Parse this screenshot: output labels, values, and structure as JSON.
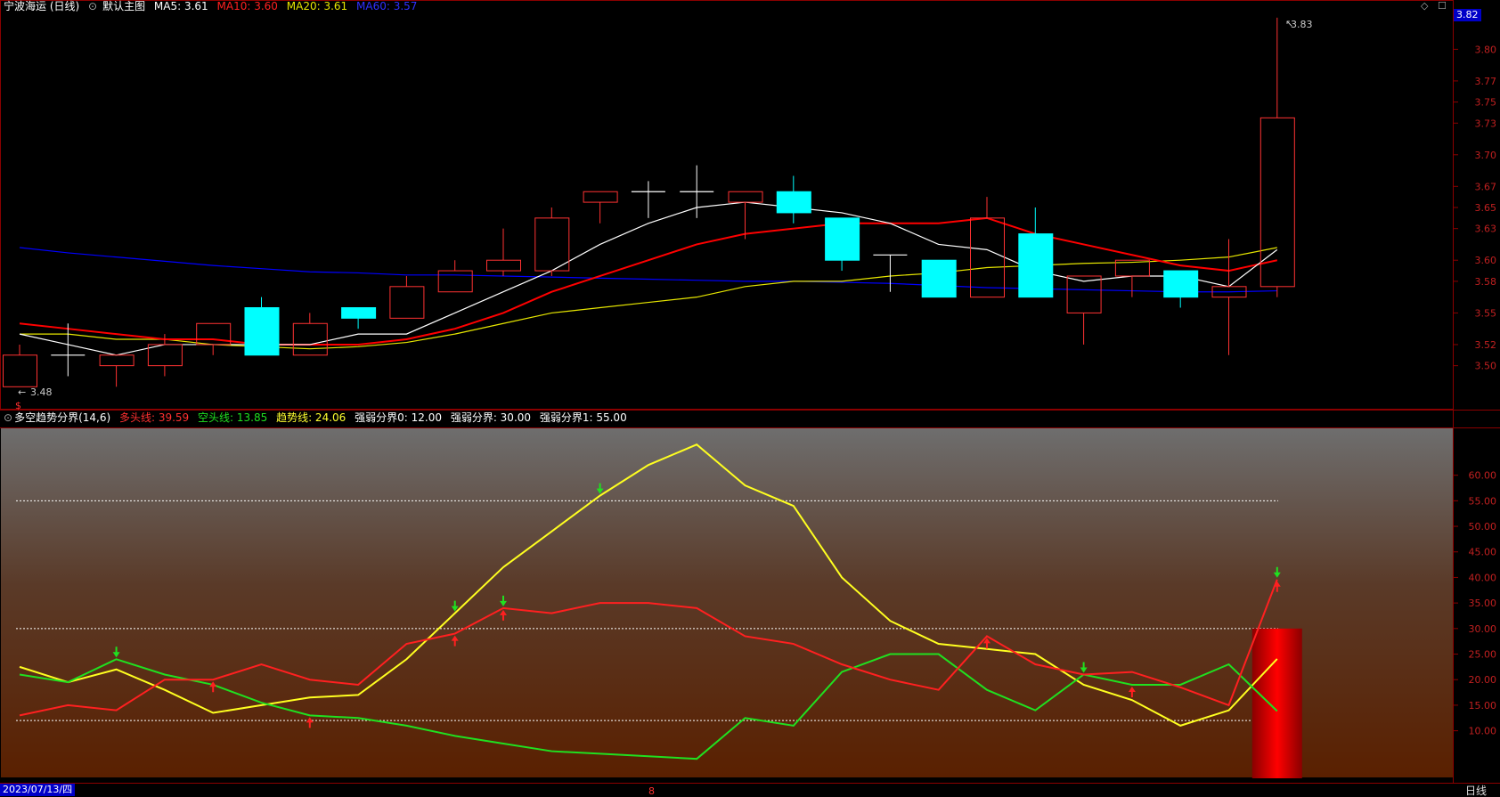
{
  "main_header": {
    "stock": "宁波海运 (日线)",
    "template": "默认主图",
    "ma5": "MA5: 3.61",
    "ma10": "MA10: 3.60",
    "ma20": "MA20: 3.61",
    "ma60": "MA60: 3.57"
  },
  "ind_header": {
    "name": "多空趋势分界(14,6)",
    "bull": "多头线: 39.59",
    "bear": "空头线: 13.85",
    "trend": "趋势线: 24.06",
    "w0": "强弱分界0: 12.00",
    "w": "强弱分界: 30.00",
    "w1": "强弱分界1: 55.00"
  },
  "price_axis": {
    "current": "3.82",
    "ticks": [
      "3.80",
      "3.77",
      "3.75",
      "3.73",
      "3.70",
      "3.67",
      "3.65",
      "3.63",
      "3.60",
      "3.58",
      "3.55",
      "3.52",
      "3.50"
    ]
  },
  "ind_axis": {
    "ticks": [
      "60.00",
      "55.00",
      "50.00",
      "45.00",
      "40.00",
      "35.00",
      "30.00",
      "25.00",
      "20.00",
      "15.00",
      "10.00"
    ]
  },
  "annotations": {
    "high": "3.83",
    "low": "3.48",
    "low_marker": "$",
    "mid_marker": "8"
  },
  "status": {
    "date": "2023/07/13/四",
    "period": "日线"
  },
  "colors": {
    "up": "#ff3232",
    "down": "#00ffff",
    "ma5": "#ffffff",
    "ma10": "#ff0000",
    "ma20": "#e6e600",
    "ma60": "#0000ff",
    "bull": "#ff2020",
    "bear": "#20e020",
    "trend": "#ffff20"
  },
  "chart_data": {
    "type": "candlestick",
    "price_range": [
      3.46,
      3.84
    ],
    "indicator_range": [
      0,
      69
    ],
    "candles": [
      {
        "o": 3.48,
        "h": 3.52,
        "l": 3.48,
        "c": 3.51
      },
      {
        "o": 3.51,
        "h": 3.54,
        "l": 3.49,
        "c": 3.51
      },
      {
        "o": 3.5,
        "h": 3.51,
        "l": 3.48,
        "c": 3.51
      },
      {
        "o": 3.5,
        "h": 3.53,
        "l": 3.49,
        "c": 3.52
      },
      {
        "o": 3.52,
        "h": 3.54,
        "l": 3.51,
        "c": 3.54
      },
      {
        "o": 3.555,
        "h": 3.565,
        "l": 3.51,
        "c": 3.51
      },
      {
        "o": 3.51,
        "h": 3.55,
        "l": 3.51,
        "c": 3.54
      },
      {
        "o": 3.555,
        "h": 3.555,
        "l": 3.535,
        "c": 3.545
      },
      {
        "o": 3.545,
        "h": 3.585,
        "l": 3.545,
        "c": 3.575
      },
      {
        "o": 3.57,
        "h": 3.6,
        "l": 3.57,
        "c": 3.59
      },
      {
        "o": 3.59,
        "h": 3.63,
        "l": 3.585,
        "c": 3.6
      },
      {
        "o": 3.59,
        "h": 3.65,
        "l": 3.585,
        "c": 3.64
      },
      {
        "o": 3.655,
        "h": 3.665,
        "l": 3.635,
        "c": 3.665
      },
      {
        "o": 3.665,
        "h": 3.675,
        "l": 3.64,
        "c": 3.665
      },
      {
        "o": 3.665,
        "h": 3.69,
        "l": 3.64,
        "c": 3.665
      },
      {
        "o": 3.655,
        "h": 3.665,
        "l": 3.62,
        "c": 3.665
      },
      {
        "o": 3.665,
        "h": 3.68,
        "l": 3.635,
        "c": 3.645
      },
      {
        "o": 3.64,
        "h": 3.64,
        "l": 3.59,
        "c": 3.6
      },
      {
        "o": 3.605,
        "h": 3.605,
        "l": 3.57,
        "c": 3.605
      },
      {
        "o": 3.6,
        "h": 3.6,
        "l": 3.565,
        "c": 3.565
      },
      {
        "o": 3.565,
        "h": 3.66,
        "l": 3.565,
        "c": 3.64
      },
      {
        "o": 3.625,
        "h": 3.65,
        "l": 3.565,
        "c": 3.565
      },
      {
        "o": 3.55,
        "h": 3.585,
        "l": 3.52,
        "c": 3.585
      },
      {
        "o": 3.585,
        "h": 3.6,
        "l": 3.565,
        "c": 3.6
      },
      {
        "o": 3.59,
        "h": 3.59,
        "l": 3.555,
        "c": 3.565
      },
      {
        "o": 3.565,
        "h": 3.62,
        "l": 3.51,
        "c": 3.575
      },
      {
        "o": 3.575,
        "h": 3.83,
        "l": 3.565,
        "c": 3.735
      }
    ],
    "ma5": [
      3.53,
      3.52,
      3.51,
      3.52,
      3.52,
      3.52,
      3.52,
      3.53,
      3.53,
      3.55,
      3.57,
      3.59,
      3.615,
      3.635,
      3.65,
      3.655,
      3.65,
      3.645,
      3.635,
      3.615,
      3.61,
      3.59,
      3.58,
      3.585,
      3.585,
      3.575,
      3.61
    ],
    "ma10": [
      3.54,
      3.535,
      3.53,
      3.525,
      3.525,
      3.52,
      3.52,
      3.52,
      3.525,
      3.535,
      3.55,
      3.57,
      3.585,
      3.6,
      3.615,
      3.625,
      3.63,
      3.635,
      3.635,
      3.635,
      3.64,
      3.625,
      3.615,
      3.605,
      3.595,
      3.59,
      3.6
    ],
    "ma20": [
      3.53,
      3.53,
      3.525,
      3.525,
      3.52,
      3.518,
      3.516,
      3.518,
      3.522,
      3.53,
      3.54,
      3.55,
      3.555,
      3.56,
      3.565,
      3.575,
      3.58,
      3.58,
      3.585,
      3.588,
      3.593,
      3.595,
      3.597,
      3.598,
      3.6,
      3.603,
      3.612
    ],
    "ma60": [
      3.612,
      3.607,
      3.603,
      3.599,
      3.595,
      3.592,
      3.589,
      3.588,
      3.586,
      3.586,
      3.585,
      3.584,
      3.583,
      3.582,
      3.581,
      3.58,
      3.58,
      3.579,
      3.578,
      3.576,
      3.574,
      3.573,
      3.572,
      3.571,
      3.57,
      3.57,
      3.571
    ],
    "bull": [
      13,
      15,
      14,
      20,
      20,
      23,
      20,
      19,
      27,
      29,
      34,
      33,
      35,
      35,
      34,
      28.5,
      27,
      23,
      20,
      18,
      28.5,
      23,
      21,
      21.5,
      18.5,
      15,
      39.59
    ],
    "bear": [
      21,
      19.5,
      24,
      21,
      19,
      15.5,
      13,
      12.5,
      11,
      9,
      7.5,
      6,
      5.5,
      5,
      4.5,
      12.5,
      11,
      21.5,
      25,
      25,
      18,
      14,
      21,
      19,
      19,
      23,
      13.85
    ],
    "trend": [
      22.5,
      19.5,
      22,
      18,
      13.5,
      15,
      16.5,
      17,
      24,
      33,
      42,
      49,
      56,
      62,
      66,
      58,
      54,
      40,
      31.5,
      27,
      26,
      25,
      19,
      16,
      11,
      14,
      24.06
    ],
    "levels": [
      12,
      30,
      55
    ],
    "markers": [
      {
        "i": 2,
        "series": "bear",
        "dir": "down"
      },
      {
        "i": 4,
        "series": "bull",
        "dir": "up"
      },
      {
        "i": 6,
        "series": "bear",
        "dir": "up"
      },
      {
        "i": 9,
        "series": "trend",
        "dir": "down"
      },
      {
        "i": 9,
        "series": "bull",
        "dir": "up"
      },
      {
        "i": 10,
        "series": "bull",
        "dir": "down"
      },
      {
        "i": 10,
        "series": "bull",
        "dir": "up"
      },
      {
        "i": 12,
        "series": "trend",
        "dir": "down"
      },
      {
        "i": 20,
        "series": "bull",
        "dir": "up"
      },
      {
        "i": 22,
        "series": "bear",
        "dir": "down"
      },
      {
        "i": 23,
        "series": "bear",
        "dir": "up"
      },
      {
        "i": 26,
        "series": "bull",
        "dir": "down"
      },
      {
        "i": 26,
        "series": "bull",
        "dir": "up"
      }
    ],
    "bar": {
      "i": 26,
      "value": 30
    }
  }
}
